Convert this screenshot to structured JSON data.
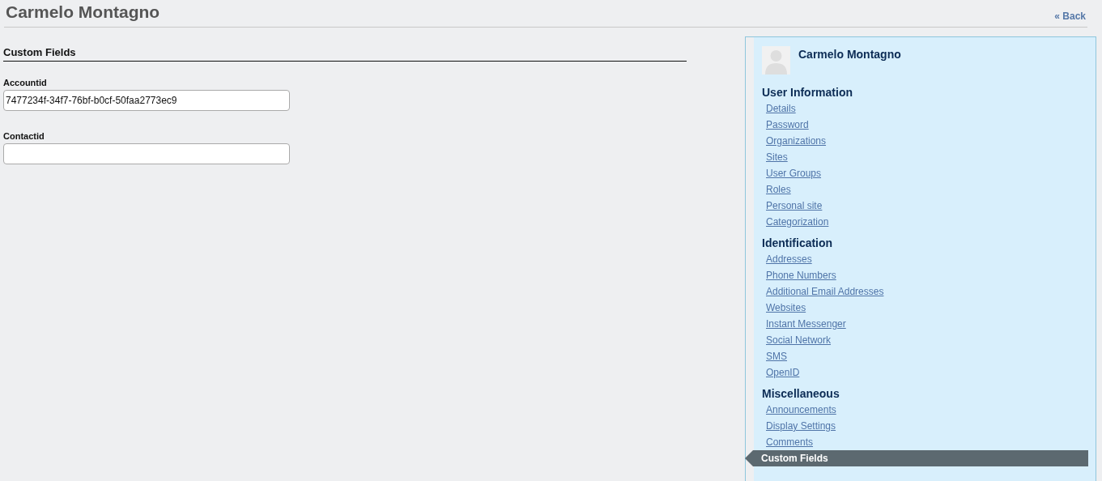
{
  "header": {
    "title": "Carmelo Montagno",
    "back_link": "« Back"
  },
  "main": {
    "section_title": "Custom Fields",
    "fields": [
      {
        "label": "Accountid",
        "value": "7477234f-34f7-76bf-b0cf-50faa2773ec9"
      },
      {
        "label": "Contactid"
      }
    ]
  },
  "sidebar": {
    "user_name": "Carmelo Montagno",
    "sections": [
      {
        "title": "User Information",
        "items": [
          {
            "label": "Details",
            "selected": false
          },
          {
            "label": "Password",
            "selected": false
          },
          {
            "label": "Organizations",
            "selected": false
          },
          {
            "label": "Sites",
            "selected": false
          },
          {
            "label": "User Groups",
            "selected": false
          },
          {
            "label": "Roles",
            "selected": false
          },
          {
            "label": "Personal site",
            "selected": false
          },
          {
            "label": "Categorization",
            "selected": false
          }
        ]
      },
      {
        "title": "Identification",
        "items": [
          {
            "label": "Addresses",
            "selected": false
          },
          {
            "label": "Phone Numbers",
            "selected": false
          },
          {
            "label": "Additional Email Addresses",
            "selected": false
          },
          {
            "label": "Websites",
            "selected": false
          },
          {
            "label": "Instant Messenger",
            "selected": false
          },
          {
            "label": "Social Network",
            "selected": false
          },
          {
            "label": "SMS",
            "selected": false
          },
          {
            "label": "OpenID",
            "selected": false
          }
        ]
      },
      {
        "title": "Miscellaneous",
        "items": [
          {
            "label": "Announcements",
            "selected": false
          },
          {
            "label": "Display Settings",
            "selected": false
          },
          {
            "label": "Comments",
            "selected": false
          },
          {
            "label": "Custom Fields",
            "selected": true
          }
        ]
      }
    ]
  }
}
